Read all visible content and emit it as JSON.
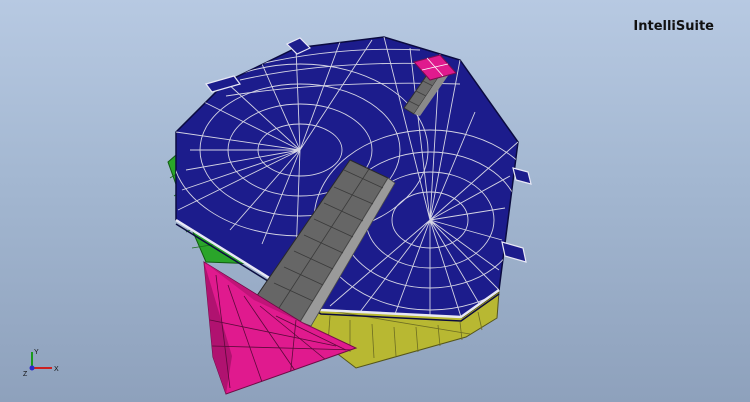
{
  "app": {
    "brand_label": "IntelliSuite"
  },
  "axis_triad": {
    "y_label": "Y",
    "z_label": "Z",
    "x_label": "X"
  },
  "colors": {
    "background_top": "#b7c9e2",
    "background_bottom": "#8ea1bc",
    "top_plate": "#1c1c8c",
    "mesh_line": "#d4d4e4",
    "beam": "#6a6a6a",
    "green_layer": "#2aa52a",
    "yellow_layer": "#b8b832",
    "magenta_block": "#e01a8e"
  }
}
